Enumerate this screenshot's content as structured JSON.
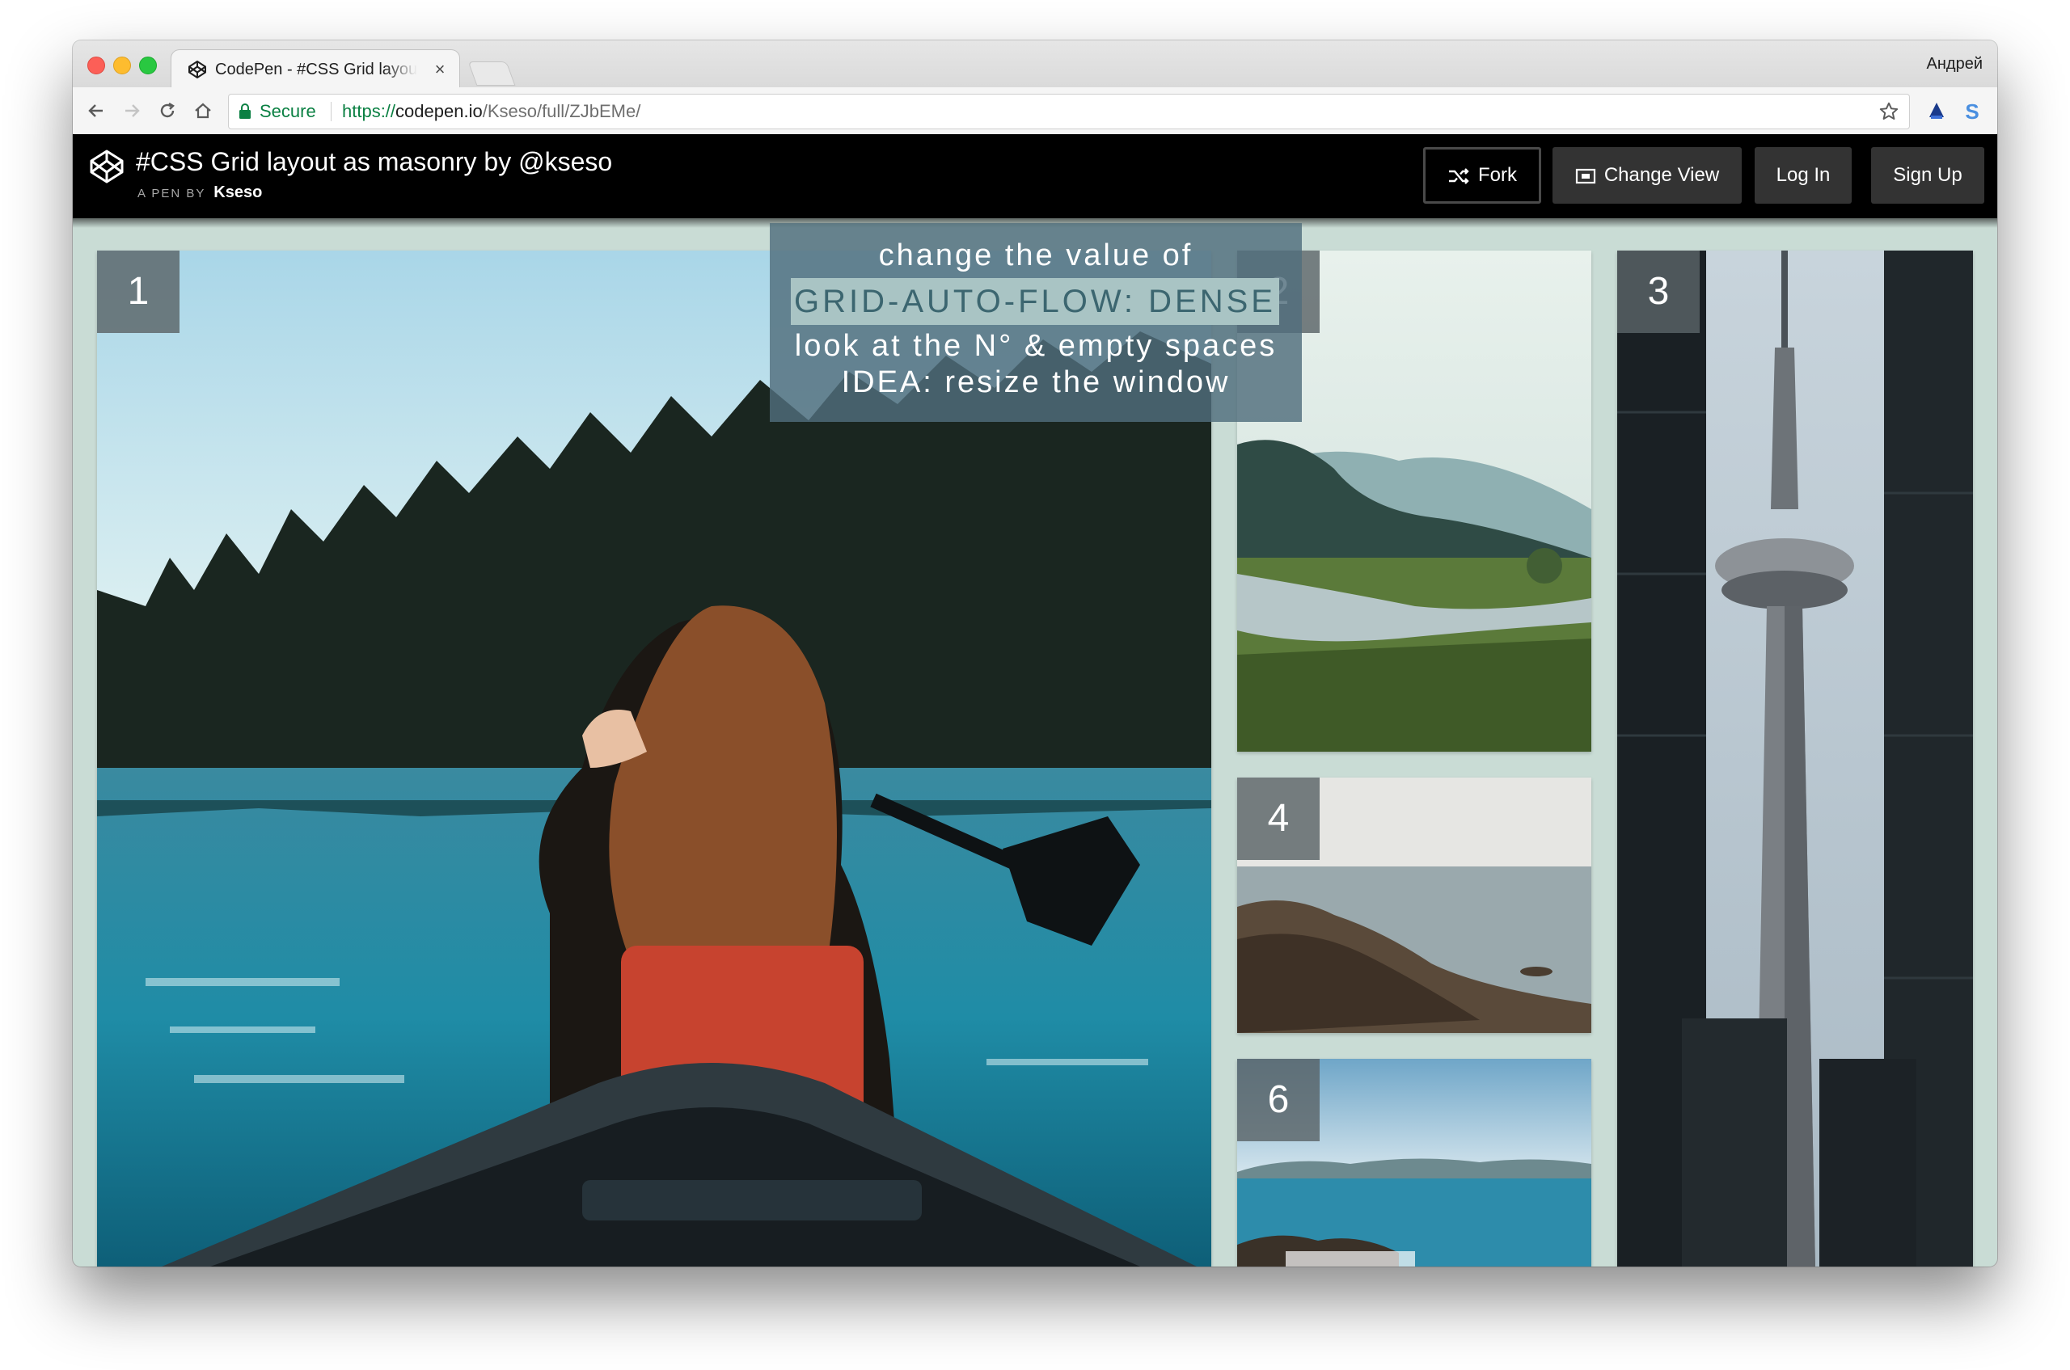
{
  "browser": {
    "tab_title": "CodePen - #CSS Grid layout as masonry by @kseso",
    "tab_close": "×",
    "profile_name": "Андрей",
    "secure_label": "Secure",
    "url": {
      "scheme": "https://",
      "host": "codepen.io",
      "path": "/Kseso/full/ZJbEMe/"
    },
    "icons": [
      "back-icon",
      "forward-icon",
      "reload-icon",
      "home-icon",
      "lock-icon",
      "star-icon",
      "extension-icon",
      "s-extension-icon",
      "menu-icon"
    ]
  },
  "codepen": {
    "title": "#CSS Grid layout as masonry by @kseso",
    "byline_prefix": "A PEN BY",
    "author": "Kseso",
    "buttons": {
      "fork": "Fork",
      "change_view": "Change View",
      "log_in": "Log In",
      "sign_up": "Sign Up"
    }
  },
  "grid": {
    "items": [
      {
        "number": "1",
        "subject": "woman in canoe on lake"
      },
      {
        "number": "2",
        "subject": "river valley landscape"
      },
      {
        "number": "3",
        "subject": "CN tower"
      },
      {
        "number": "4",
        "subject": "rocky shore"
      },
      {
        "number": "6",
        "subject": "sea view"
      }
    ]
  },
  "overlay": {
    "line1": "change the value of",
    "code": "grid-auto-flow: dense",
    "line3": "look at the N° & empty spaces",
    "line4": "IDEA: resize the window"
  },
  "colors": {
    "page_background": "#c9dcd5",
    "codepen_header": "#000000",
    "button_background": "#333333",
    "secure_green": "#0b8043",
    "overlay": "#506e7c",
    "code_highlight": "#a9c4c4"
  }
}
